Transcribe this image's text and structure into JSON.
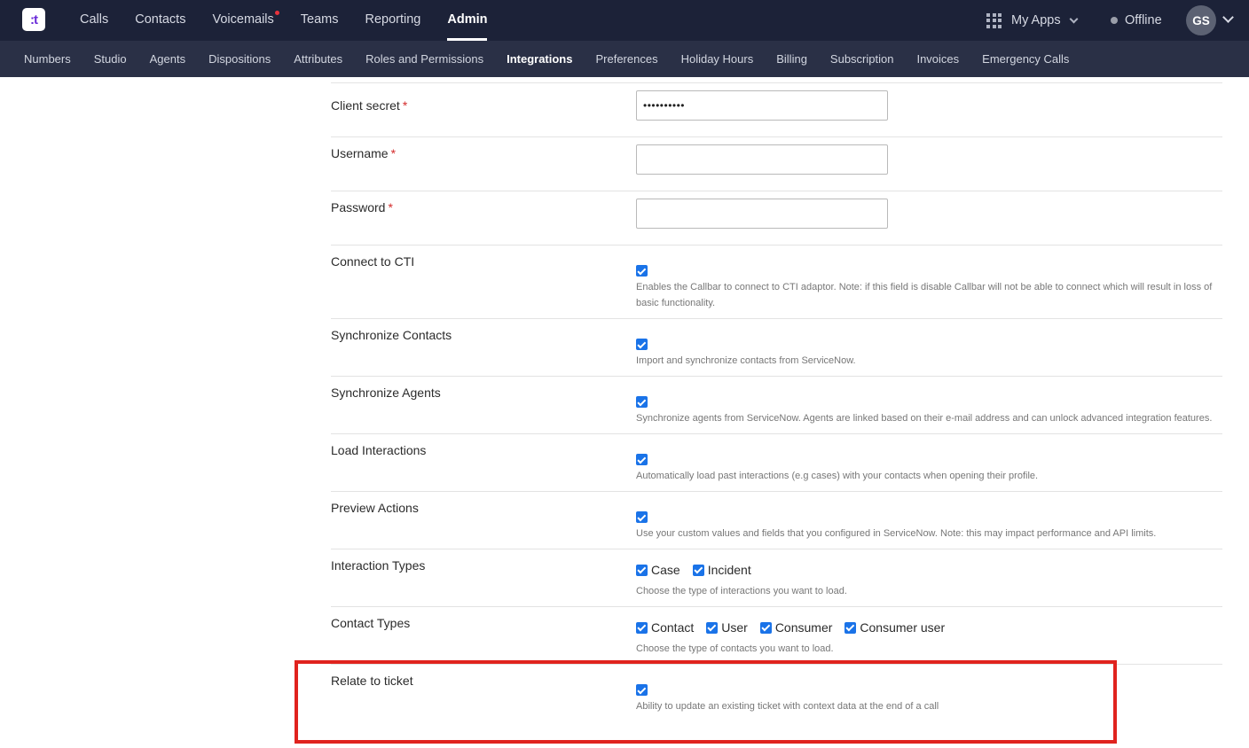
{
  "header": {
    "logo_text": ":t",
    "nav": [
      {
        "label": "Calls",
        "active": false,
        "notify": false
      },
      {
        "label": "Contacts",
        "active": false,
        "notify": false
      },
      {
        "label": "Voicemails",
        "active": false,
        "notify": true
      },
      {
        "label": "Teams",
        "active": false,
        "notify": false
      },
      {
        "label": "Reporting",
        "active": false,
        "notify": false
      },
      {
        "label": "Admin",
        "active": true,
        "notify": false
      }
    ],
    "my_apps": "My Apps",
    "status": "Offline",
    "avatar_initials": "GS"
  },
  "subnav": [
    {
      "label": "Numbers",
      "active": false
    },
    {
      "label": "Studio",
      "active": false
    },
    {
      "label": "Agents",
      "active": false
    },
    {
      "label": "Dispositions",
      "active": false
    },
    {
      "label": "Attributes",
      "active": false
    },
    {
      "label": "Roles and Permissions",
      "active": false
    },
    {
      "label": "Integrations",
      "active": true
    },
    {
      "label": "Preferences",
      "active": false
    },
    {
      "label": "Holiday Hours",
      "active": false
    },
    {
      "label": "Billing",
      "active": false
    },
    {
      "label": "Subscription",
      "active": false
    },
    {
      "label": "Invoices",
      "active": false
    },
    {
      "label": "Emergency Calls",
      "active": false
    }
  ],
  "form": {
    "client_secret": {
      "label": "Client secret",
      "required": "*",
      "value": "••••••••••"
    },
    "username": {
      "label": "Username",
      "required": "*",
      "value": ""
    },
    "password": {
      "label": "Password",
      "required": "*",
      "value": ""
    },
    "connect_cti": {
      "label": "Connect to CTI",
      "checked": true,
      "hint": "Enables the Callbar to connect to CTI adaptor. Note: if this field is disable Callbar will not be able to connect which will result in loss of basic functionality."
    },
    "sync_contacts": {
      "label": "Synchronize Contacts",
      "checked": true,
      "hint": "Import and synchronize contacts from ServiceNow."
    },
    "sync_agents": {
      "label": "Synchronize Agents",
      "checked": true,
      "hint": "Synchronize agents from ServiceNow. Agents are linked based on their e-mail address and can unlock advanced integration features."
    },
    "load_interactions": {
      "label": "Load Interactions",
      "checked": true,
      "hint": "Automatically load past interactions (e.g cases) with your contacts when opening their profile."
    },
    "preview_actions": {
      "label": "Preview Actions",
      "checked": true,
      "hint": "Use your custom values and fields that you configured in ServiceNow. Note: this may impact performance and API limits."
    },
    "interaction_types": {
      "label": "Interaction Types",
      "options": [
        {
          "label": "Case",
          "checked": true
        },
        {
          "label": "Incident",
          "checked": true
        }
      ],
      "hint": "Choose the type of interactions you want to load."
    },
    "contact_types": {
      "label": "Contact Types",
      "options": [
        {
          "label": "Contact",
          "checked": true
        },
        {
          "label": "User",
          "checked": true
        },
        {
          "label": "Consumer",
          "checked": true
        },
        {
          "label": "Consumer user",
          "checked": true
        }
      ],
      "hint": "Choose the type of contacts you want to load."
    },
    "relate_ticket": {
      "label": "Relate to ticket",
      "checked": true,
      "hint": "Ability to update an existing ticket with context data at the end of a call"
    }
  },
  "colors": {
    "topbar": "#1c2238",
    "subbar": "#2a3046",
    "checkbox": "#1a73e8",
    "required": "#d42b2b",
    "highlight": "#e0231e"
  }
}
